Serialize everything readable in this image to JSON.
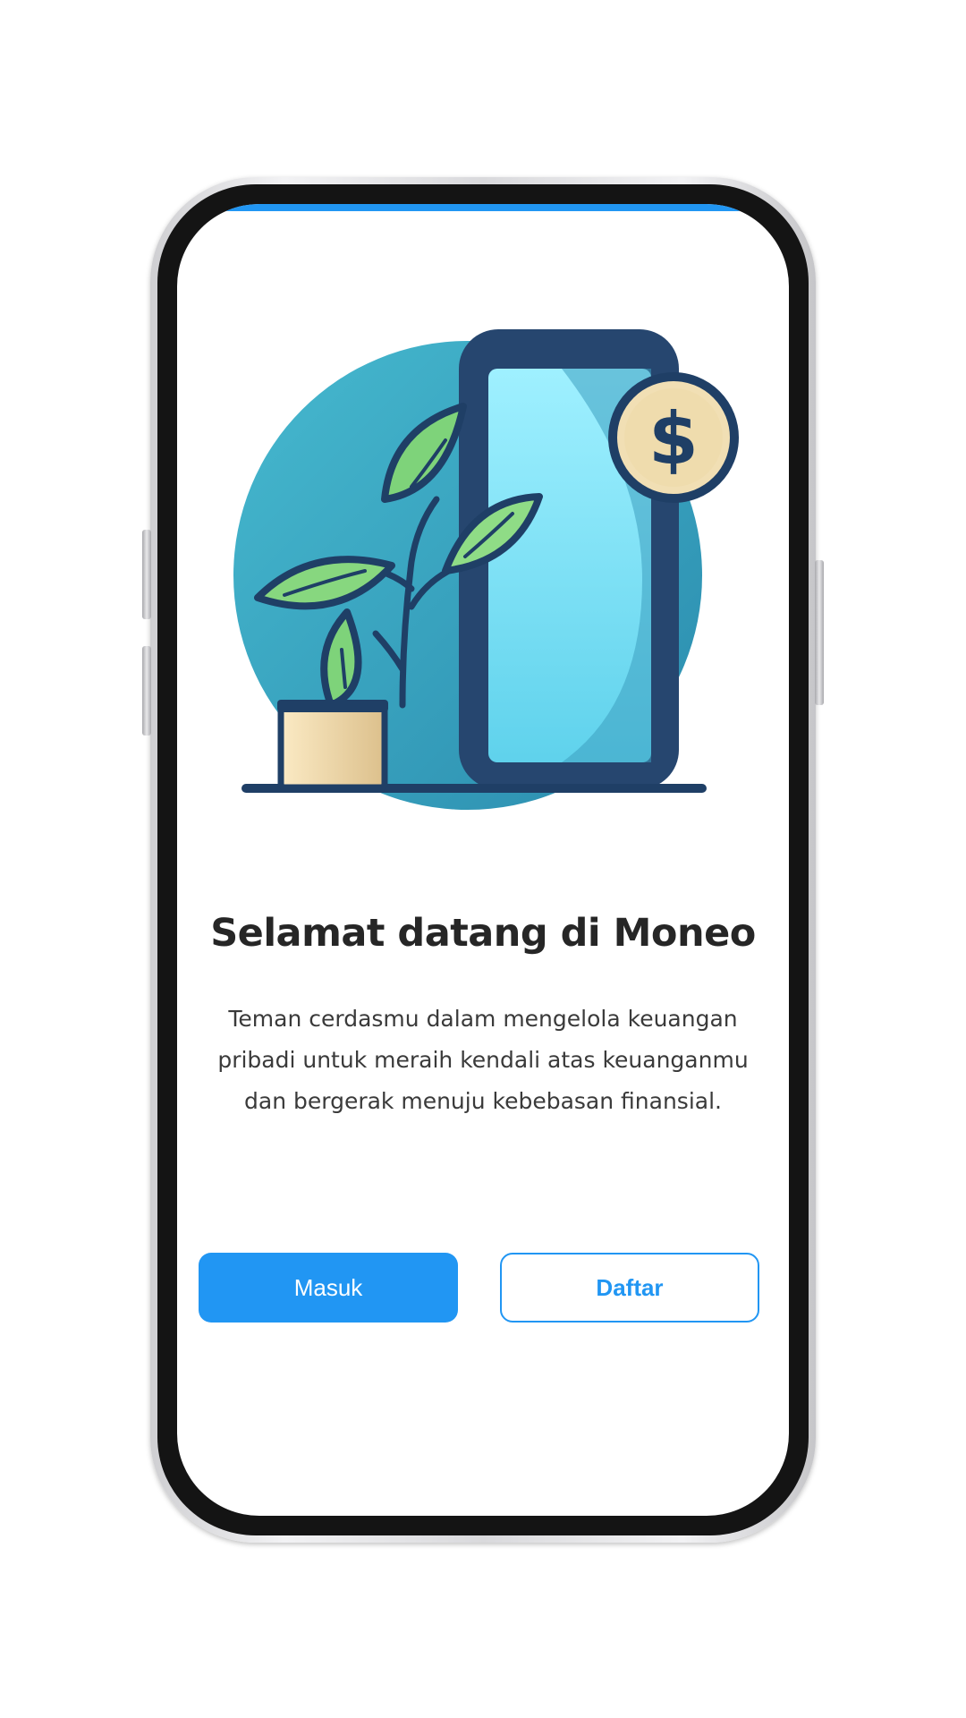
{
  "welcome": {
    "title": "Selamat datang di Moneo",
    "description": "Teman cerdasmu dalam mengelola keuangan pribadi untuk meraih kendali atas keuanganmu dan bergerak menuju kebebasan finansial."
  },
  "actions": {
    "login_label": "Masuk",
    "register_label": "Daftar"
  },
  "colors": {
    "primary": "#2196f3",
    "title_text": "#262626",
    "body_text": "#3a3a3a",
    "illustration_circle": "#3aa7c4",
    "illustration_phone": "#244a74",
    "illustration_leaf": "#7ed37a",
    "illustration_coin": "#f1dfb4"
  },
  "icons": {
    "illustration": "plant-phone-coin-illustration",
    "coin": "dollar-coin-icon"
  }
}
